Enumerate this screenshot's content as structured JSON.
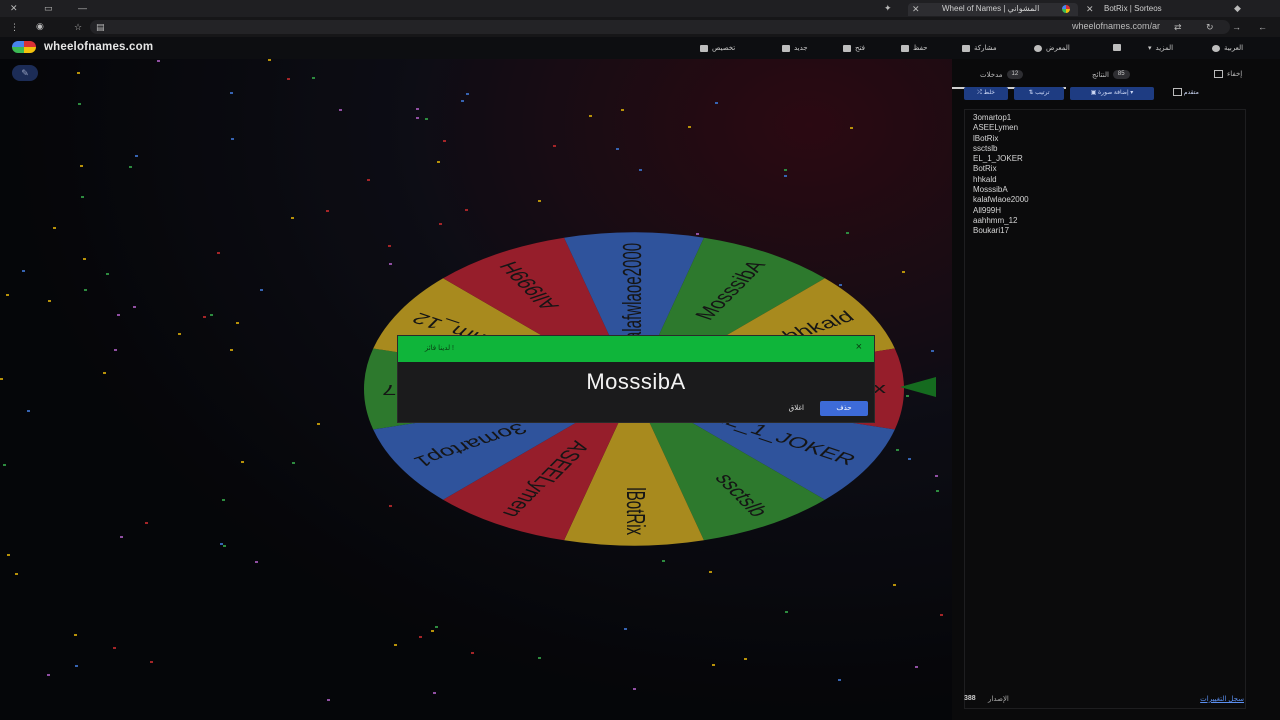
{
  "browser": {
    "tabs": [
      {
        "label": "Wheel of Names | المشواني"
      },
      {
        "label": "BotRix | Sorteos"
      }
    ],
    "url": "wheelofnames.com/ar"
  },
  "app": {
    "site_name": "wheelofnames.com",
    "menu": [
      {
        "label": "العربية",
        "icon": "globe-icon"
      },
      {
        "label": "المزيد",
        "icon": "chevron-down-icon"
      },
      {
        "label": "",
        "icon": "fullscreen-icon"
      },
      {
        "label": "المعرض",
        "icon": "search-icon"
      },
      {
        "label": "مشاركة",
        "icon": "share-icon"
      },
      {
        "label": "حفظ",
        "icon": "save-icon"
      },
      {
        "label": "فتح",
        "icon": "folder-icon"
      },
      {
        "label": "جديد",
        "icon": "new-file-icon"
      },
      {
        "label": "تخصيص",
        "icon": "palette-icon"
      }
    ]
  },
  "wheel": {
    "segments": [
      {
        "name": "Boukari17",
        "color": "#3ca23c"
      },
      {
        "name": "aahhmm_12",
        "color": "#e0b928"
      },
      {
        "name": "All999H",
        "color": "#c8283a"
      },
      {
        "name": "kalafwlaoe2000",
        "color": "#3f6fd1"
      },
      {
        "name": "MosssibA",
        "color": "#3ca23c"
      },
      {
        "name": "hhkald",
        "color": "#e0b928"
      },
      {
        "name": "BotRix",
        "color": "#c8283a"
      },
      {
        "name": "EL_1_JOKER",
        "color": "#3f6fd1"
      },
      {
        "name": "ssctslb",
        "color": "#3ca23c"
      },
      {
        "name": "lBotRix",
        "color": "#e0b928"
      },
      {
        "name": "ASEELymen",
        "color": "#c8283a"
      },
      {
        "name": "3omartop1",
        "color": "#3f6fd1"
      }
    ]
  },
  "dialog": {
    "title": "لدينا فائز !",
    "winner": "MosssibA",
    "remove_label": "حذف",
    "close_label": "اغلاق",
    "close_icon": "×"
  },
  "panel": {
    "tabs": [
      {
        "label": "مدخلات",
        "count": "12"
      },
      {
        "label": "النتائج",
        "count": "85"
      }
    ],
    "hide_label": "إخفاء",
    "tools": {
      "shuffle": "خلط",
      "sort": "ترتيب",
      "add_image": "إضافة صورة",
      "advanced": "متقدم"
    },
    "entries": [
      "3omartop1",
      "ASEELymen",
      "lBotRix",
      "ssctslb",
      "EL_1_JOKER",
      "BotRix",
      "hhkald",
      "MosssibA",
      "kalafwlaoe2000",
      "All999H",
      "aahhmm_12",
      "Boukari17"
    ],
    "version_label": "الإصدار",
    "version_value": "388",
    "changelog_link": "سجل التغييرات"
  }
}
